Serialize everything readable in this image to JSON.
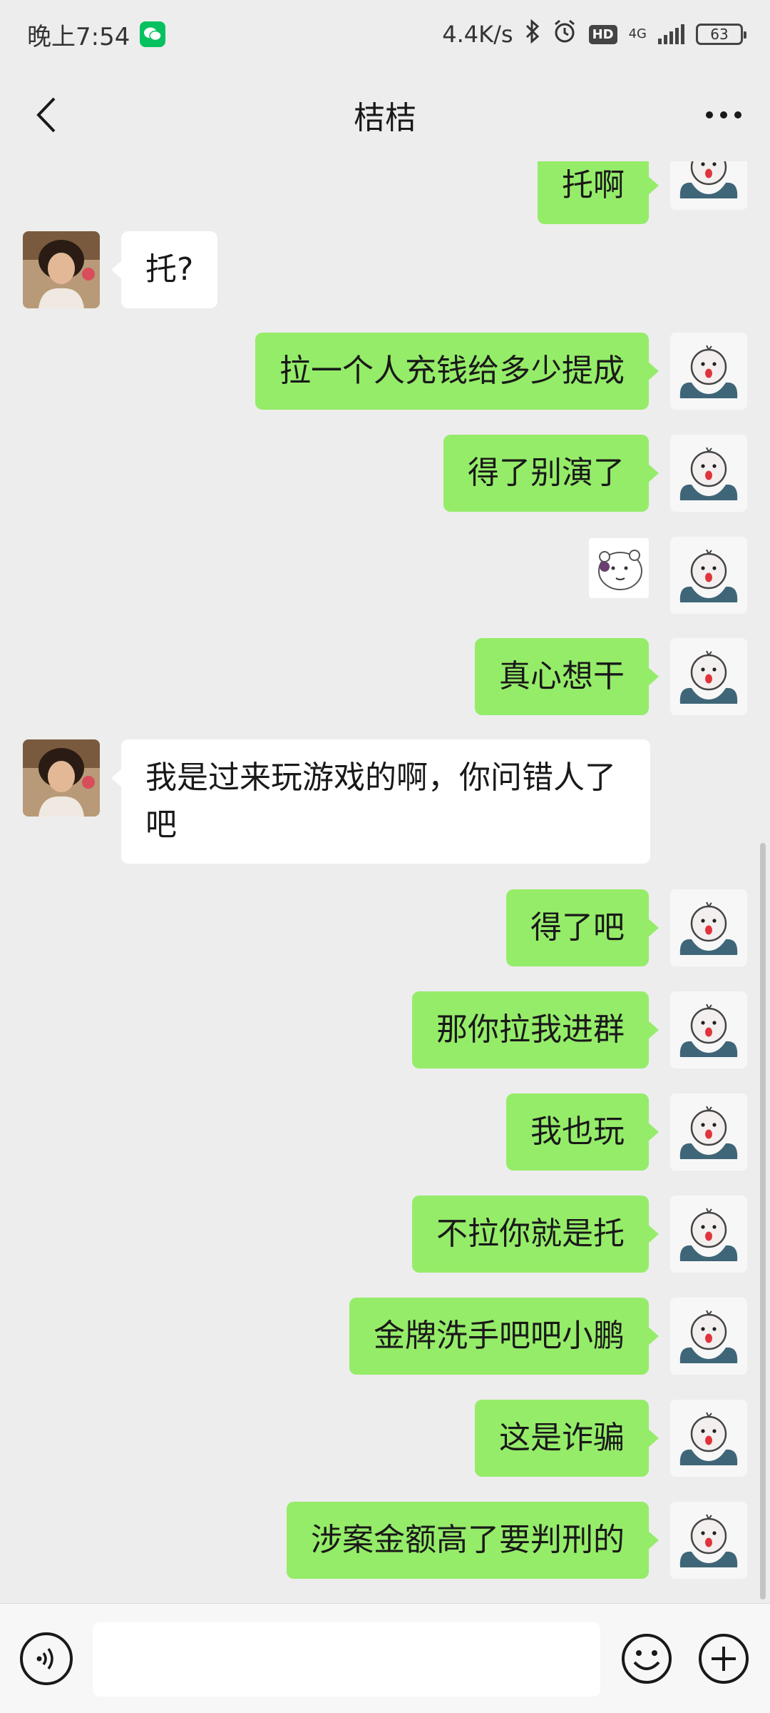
{
  "status_bar": {
    "time": "晚上7:54",
    "speed": "4.4K/s",
    "hd": "HD",
    "network": "4G",
    "battery": "63"
  },
  "header": {
    "title": "桔桔"
  },
  "messages": [
    {
      "from": "me",
      "text": "托啊"
    },
    {
      "from": "them",
      "text": "托?"
    },
    {
      "from": "me",
      "text": "拉一个人充钱给多少提成"
    },
    {
      "from": "me",
      "text": "得了别演了"
    },
    {
      "from": "me",
      "type": "sticker",
      "icon": "bear-sticker-icon"
    },
    {
      "from": "me",
      "text": "真心想干"
    },
    {
      "from": "them",
      "text": "我是过来玩游戏的啊，你问错人了吧"
    },
    {
      "from": "me",
      "text": "得了吧"
    },
    {
      "from": "me",
      "text": "那你拉我进群"
    },
    {
      "from": "me",
      "text": "我也玩"
    },
    {
      "from": "me",
      "text": "不拉你就是托"
    },
    {
      "from": "me",
      "text": "金牌洗手吧吧小鹏"
    },
    {
      "from": "me",
      "text": "这是诈骗"
    },
    {
      "from": "me",
      "text": "涉案金额高了要判刑的"
    }
  ],
  "input_bar": {
    "value": "",
    "voice_icon": "voice-icon",
    "emoji_icon": "emoji-icon",
    "plus_icon": "plus-icon"
  },
  "colors": {
    "my_bubble": "#95ec69",
    "their_bubble": "#ffffff",
    "background": "#ededed"
  }
}
